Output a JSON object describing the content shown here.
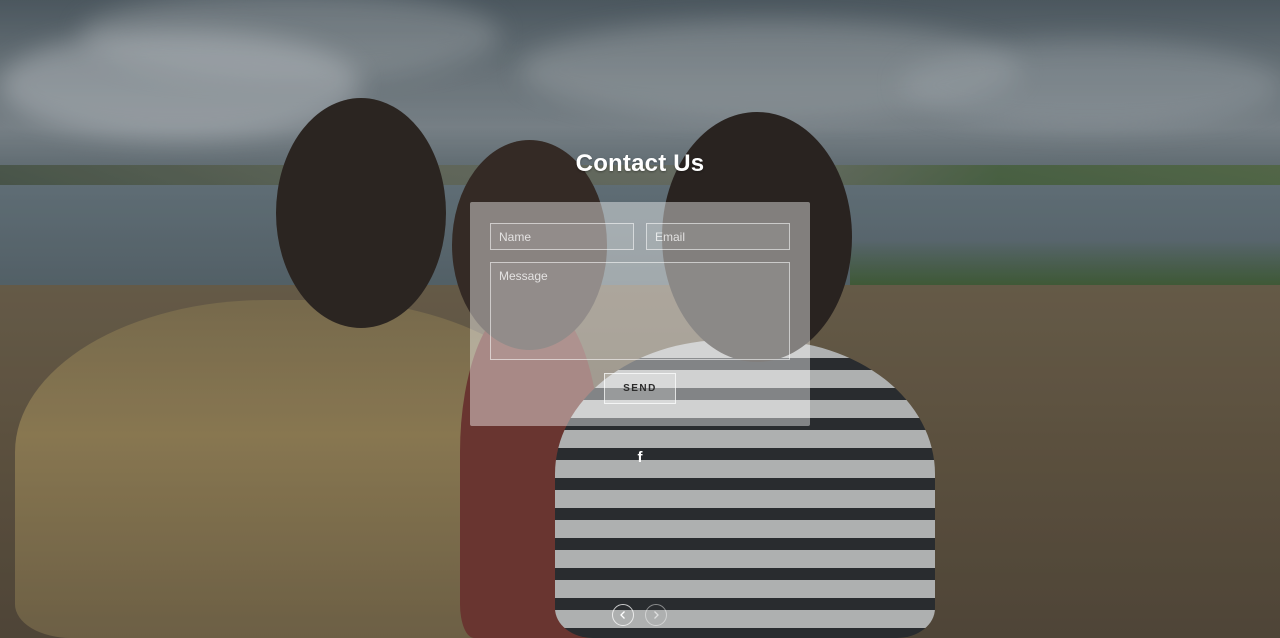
{
  "contact": {
    "title": "Contact Us",
    "name_placeholder": "Name",
    "email_placeholder": "Email",
    "message_placeholder": "Message",
    "send_label": "SEND"
  },
  "social": {
    "facebook_icon": "facebook-icon",
    "facebook_glyph": "f"
  },
  "slider": {
    "prev_icon": "chevron-left-icon",
    "next_icon": "chevron-right-icon"
  },
  "colors": {
    "title": "#ffffff",
    "panel": "rgba(255,255,255,0.42)"
  }
}
